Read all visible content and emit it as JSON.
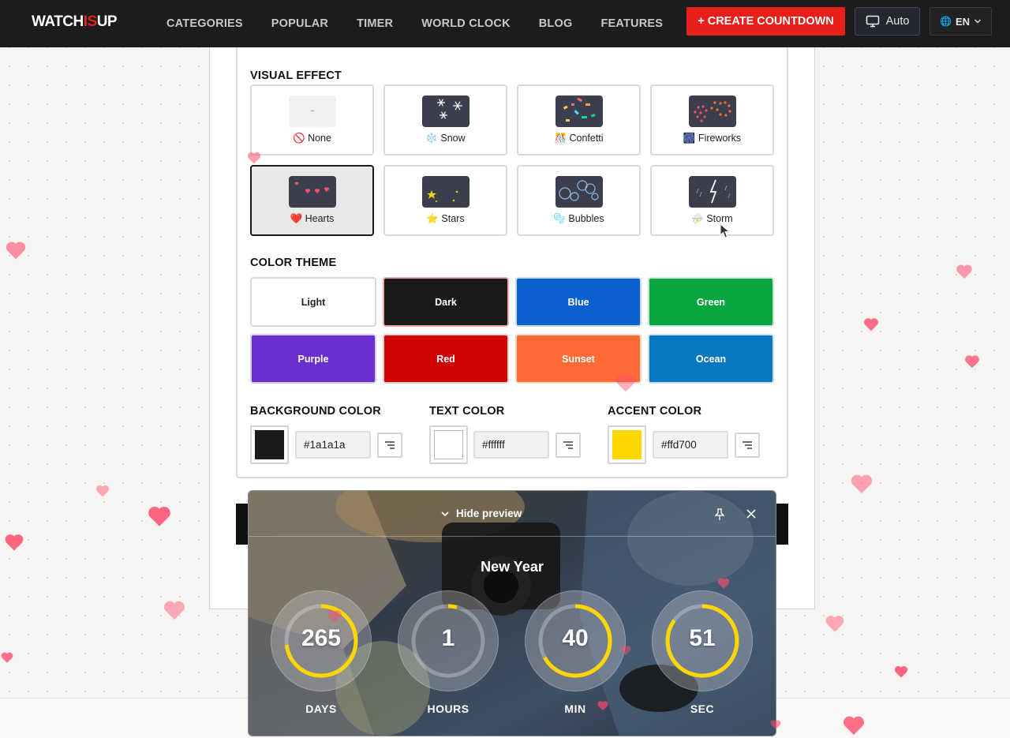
{
  "nav": {
    "logo_a": "WATCH",
    "logo_b": "IS",
    "logo_c": "UP",
    "links": [
      "CATEGORIES",
      "POPULAR",
      "TIMER",
      "WORLD CLOCK",
      "BLOG",
      "FEATURES"
    ],
    "cta": "+ CREATE COUNTDOWN",
    "display_mode": "Auto",
    "language": "EN"
  },
  "visual_effect": {
    "title": "VISUAL EFFECT",
    "items": [
      {
        "label": "🚫 None",
        "icon": "none-icon"
      },
      {
        "label": "❄️ Snow",
        "icon": "snow-icon"
      },
      {
        "label": "🎊 Confetti",
        "icon": "confetti-icon"
      },
      {
        "label": "🎆 Fireworks",
        "icon": "fireworks-icon"
      },
      {
        "label": "❤️ Hearts",
        "icon": "hearts-icon",
        "selected": true
      },
      {
        "label": "⭐ Stars",
        "icon": "stars-icon"
      },
      {
        "label": "🫧 Bubbles",
        "icon": "bubbles-icon"
      },
      {
        "label": "⛈️ Storm",
        "icon": "storm-icon"
      }
    ]
  },
  "color_theme": {
    "title": "COLOR THEME",
    "items": [
      {
        "label": "Light",
        "color": "#ffffff"
      },
      {
        "label": "Dark",
        "color": "#1a1a1a",
        "selected": true
      },
      {
        "label": "Blue",
        "color": "#0a5fd1"
      },
      {
        "label": "Green",
        "color": "#07a63e"
      },
      {
        "label": "Purple",
        "color": "#6a2fcf"
      },
      {
        "label": "Red",
        "color": "#d10404"
      },
      {
        "label": "Sunset",
        "color": "#ff6b35"
      },
      {
        "label": "Ocean",
        "color": "#0a77c2"
      }
    ]
  },
  "colors": {
    "background": {
      "label": "BACKGROUND COLOR",
      "value": "#1a1a1a"
    },
    "text": {
      "label": "TEXT COLOR",
      "value": "#ffffff"
    },
    "accent": {
      "label": "ACCENT COLOR",
      "value": "#ffd700"
    }
  },
  "preview": {
    "toggle_label": "Hide preview",
    "title": "New Year",
    "units": [
      {
        "value": "265",
        "label": "DAYS",
        "progress": 0.73
      },
      {
        "value": "1",
        "label": "HOURS",
        "progress": 0.04
      },
      {
        "value": "40",
        "label": "MIN",
        "progress": 0.67
      },
      {
        "value": "51",
        "label": "SEC",
        "progress": 0.85
      }
    ]
  }
}
